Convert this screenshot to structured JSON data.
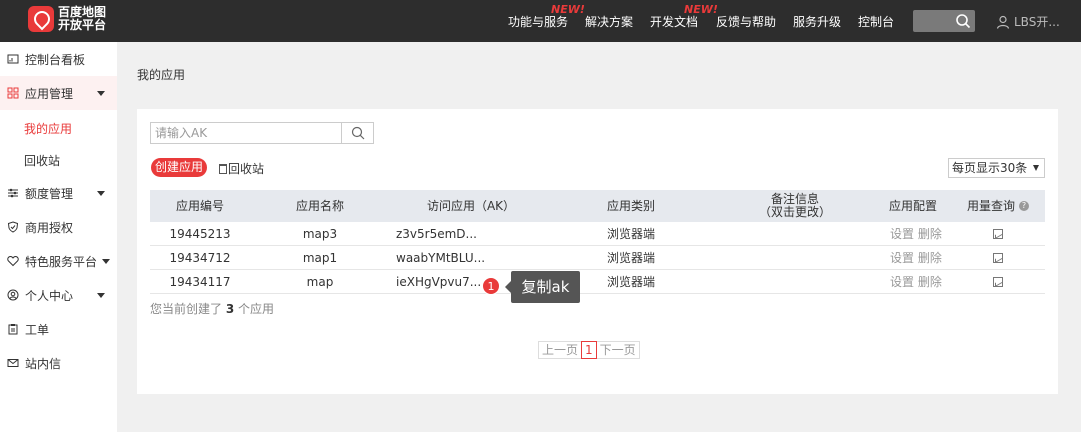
{
  "topbar": {
    "logo_line1": "百度地图",
    "logo_line2": "开放平台",
    "nav": [
      {
        "label": "功能与服务",
        "new": "NEW!"
      },
      {
        "label": "解决方案"
      },
      {
        "label": "开发文档",
        "new": "NEW!"
      },
      {
        "label": "反馈与帮助"
      },
      {
        "label": "服务升级"
      },
      {
        "label": "控制台"
      }
    ],
    "user": "LBS开..."
  },
  "sidebar": {
    "items": [
      {
        "label": "控制台看板",
        "icon": "dashboard-icon"
      },
      {
        "label": "应用管理",
        "icon": "grid-icon"
      },
      {
        "label": "额度管理",
        "icon": "sliders-icon"
      },
      {
        "label": "商用授权",
        "icon": "shield-icon"
      },
      {
        "label": "特色服务平台",
        "icon": "heart-icon"
      },
      {
        "label": "个人中心",
        "icon": "user-circle-icon"
      },
      {
        "label": "工单",
        "icon": "clipboard-icon"
      },
      {
        "label": "站内信",
        "icon": "mail-icon"
      }
    ],
    "sub": [
      "我的应用",
      "回收站"
    ]
  },
  "main": {
    "breadcrumb": "我的应用",
    "search_placeholder": "请输入AK",
    "create_label": "创建应用",
    "recycle_label": "回收站",
    "per_page": "每页显示30条",
    "columns": [
      "应用编号",
      "应用名称",
      "访问应用（AK）",
      "应用类别",
      "备注信息",
      "（双击更改）",
      "应用配置",
      "用量查询"
    ],
    "rows": [
      {
        "id": "19445213",
        "name": "map3",
        "ak": "z3v5r5emD...",
        "type": "浏览器端",
        "note": ""
      },
      {
        "id": "19434712",
        "name": "map1",
        "ak": "waabYMtBLU...",
        "type": "浏览器端",
        "note": ""
      },
      {
        "id": "19434117",
        "name": "map",
        "ak": "ieXHgVpvu7...",
        "type": "浏览器端",
        "note": ""
      }
    ],
    "action_settings": "设置",
    "action_delete": "删除",
    "summary_prefix": "您当前创建了",
    "summary_count": "3",
    "summary_suffix": "个应用",
    "pager": {
      "prev": "上一页",
      "current": "1",
      "next": "下一页"
    }
  },
  "tooltip": {
    "step": "1",
    "text": "复制ak"
  },
  "colors": {
    "accent": "#e93a3a",
    "topbar": "#2d2d2d",
    "header_row": "#e6e9ee"
  }
}
